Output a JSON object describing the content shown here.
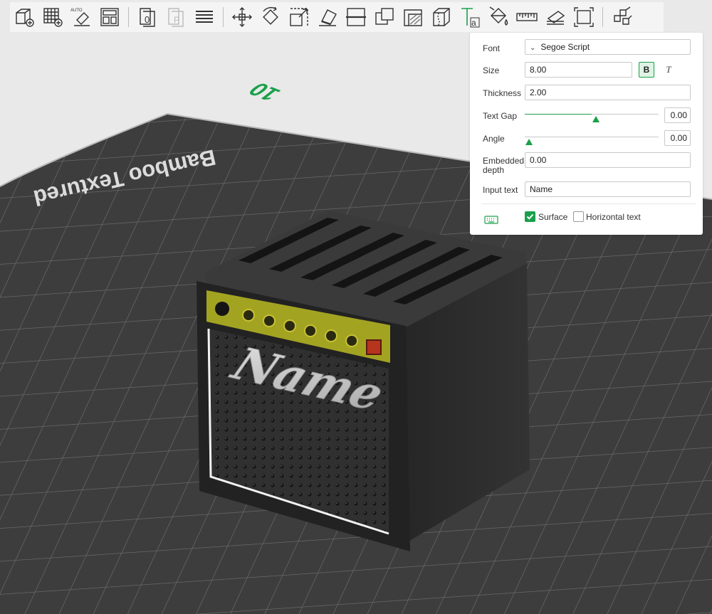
{
  "toolbar": {
    "tools": [
      {
        "name": "add-part-icon"
      },
      {
        "name": "add-plate-icon"
      },
      {
        "name": "auto-orient-icon",
        "label": "AUTO"
      },
      {
        "name": "arrange-icon"
      },
      {
        "name": "split-to-objects-icon"
      },
      {
        "name": "split-to-parts-icon"
      },
      {
        "name": "layers-icon"
      },
      {
        "name": "move-icon"
      },
      {
        "name": "rotate-icon"
      },
      {
        "name": "scale-icon"
      },
      {
        "name": "lay-on-face-icon"
      },
      {
        "name": "cut-icon"
      },
      {
        "name": "boolean-icon"
      },
      {
        "name": "support-paint-icon"
      },
      {
        "name": "seam-paint-icon"
      },
      {
        "name": "text-tool-icon"
      },
      {
        "name": "color-paint-icon"
      },
      {
        "name": "measure-icon"
      },
      {
        "name": "assembly-icon"
      },
      {
        "name": "fit-view-icon"
      },
      {
        "name": "explode-icon"
      }
    ]
  },
  "scene": {
    "plate_label": "Bamboo Textured",
    "plate_number": "10",
    "embossed_text": "Name"
  },
  "text_panel": {
    "font_label": "Font",
    "font_value": "Segoe Script",
    "size_label": "Size",
    "size_value": "8.00",
    "bold_label": "B",
    "italic_label": "T",
    "thickness_label": "Thickness",
    "thickness_value": "2.00",
    "text_gap_label": "Text Gap",
    "text_gap_value": "0.00",
    "text_gap_slider": 0.5,
    "angle_label": "Angle",
    "angle_value": "0.00",
    "angle_slider": 0.0,
    "embedded_label_1": "Embedded",
    "embedded_label_2": "depth",
    "embedded_value": "0.00",
    "input_text_label": "Input text",
    "input_text_value": "Name",
    "surface_label": "Surface",
    "surface_checked": true,
    "horizontal_label": "Horizontal text",
    "horizontal_checked": false,
    "accent_color": "#1aa04a"
  }
}
